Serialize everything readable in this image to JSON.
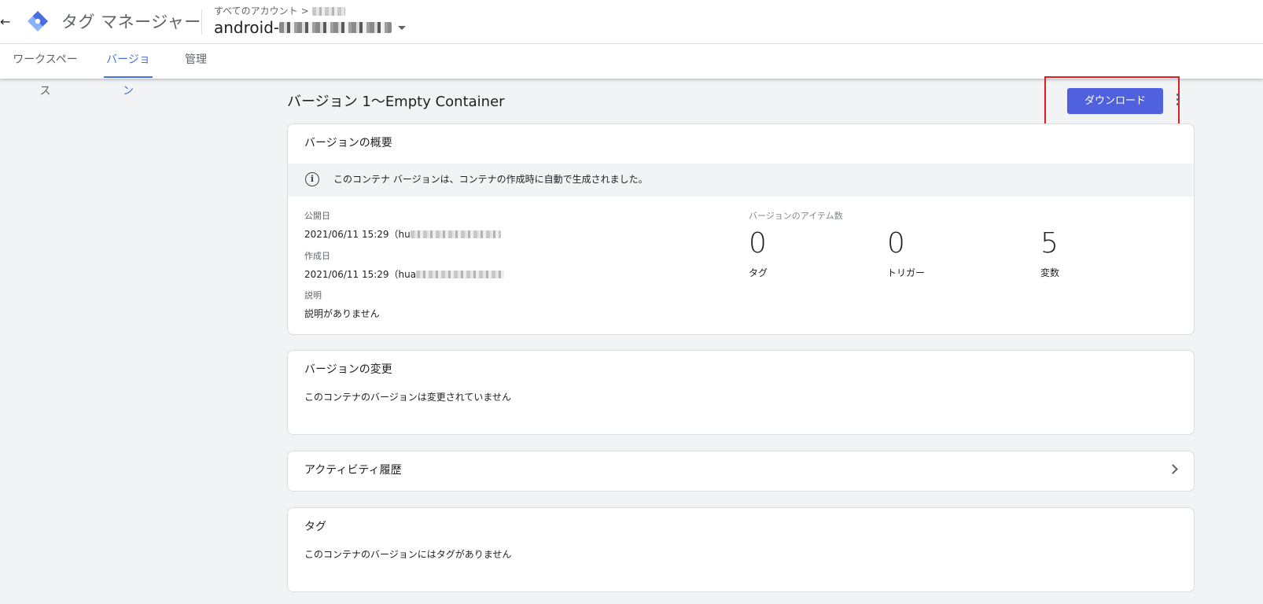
{
  "header": {
    "back_icon": "arrow-back-icon",
    "logo_icon": "tag-manager-logo-icon",
    "brand_color": "#4a6ee0",
    "app_title": "タグ マネージャー",
    "breadcrumb": {
      "prefix": "すべてのアカウント",
      "separator": ">"
    },
    "container_name_prefix": "android-"
  },
  "tabs": [
    {
      "label": "ワークスペース",
      "active": false
    },
    {
      "label": "バージョン",
      "active": true
    },
    {
      "label": "管理",
      "active": false
    }
  ],
  "page": {
    "title": "バージョン 1～Empty Container",
    "download_label": "ダウンロード",
    "download_color": "#5061e0",
    "highlight_color": "#e01b22"
  },
  "summary": {
    "title": "バージョンの概要",
    "info_text": "このコンテナ バージョンは、コンテナの作成時に自動で生成されました。",
    "published_label": "公開日",
    "published_value": "2021/06/11 15:29（hu",
    "created_label": "作成日",
    "created_value": "2021/06/11 15:29（hua",
    "description_label": "説明",
    "description_value": "説明がありません",
    "counts_label": "バージョンのアイテム数",
    "counts": [
      {
        "value": "0",
        "label": "タグ"
      },
      {
        "value": "0",
        "label": "トリガー"
      },
      {
        "value": "5",
        "label": "変数"
      }
    ]
  },
  "changes": {
    "title": "バージョンの変更",
    "text": "このコンテナのバージョンは変更されていません"
  },
  "activity": {
    "title": "アクティビティ履歴"
  },
  "tags_card": {
    "title": "タグ",
    "text": "このコンテナのバージョンにはタグがありません"
  }
}
